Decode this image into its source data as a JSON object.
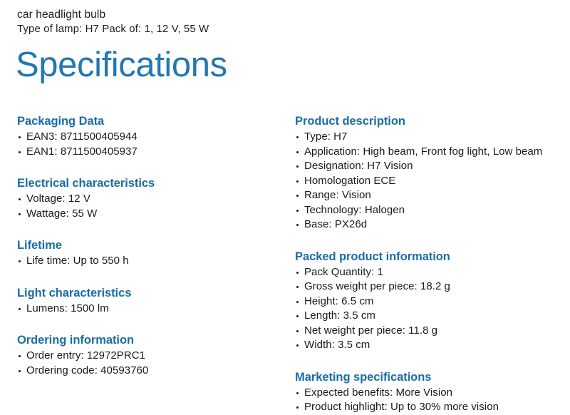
{
  "header": {
    "product_name": "car headlight bulb",
    "product_subtitle": "Type of lamp: H7 Pack of: 1, 12 V, 55 W",
    "page_title": "Specifications"
  },
  "colors": {
    "title_blue": "#2278b0",
    "heading_blue": "#1a6da5",
    "body_text": "#1a1a1a",
    "background": "#ffffff"
  },
  "left_column": [
    {
      "heading": "Packaging Data",
      "items": [
        "EAN3: 8711500405944",
        "EAN1: 8711500405937"
      ]
    },
    {
      "heading": "Electrical characteristics",
      "items": [
        "Voltage: 12 V",
        "Wattage: 55 W"
      ]
    },
    {
      "heading": "Lifetime",
      "items": [
        "Life time: Up to 550 h"
      ]
    },
    {
      "heading": "Light characteristics",
      "items": [
        "Lumens: 1500 lm"
      ]
    },
    {
      "heading": "Ordering information",
      "items": [
        "Order entry: 12972PRC1",
        "Ordering code: 40593760"
      ]
    }
  ],
  "right_column": [
    {
      "heading": "Product description",
      "items": [
        "Type: H7",
        "Application: High beam, Front fog light, Low beam",
        "Designation: H7 Vision",
        "Homologation ECE",
        "Range: Vision",
        "Technology: Halogen",
        "Base: PX26d"
      ]
    },
    {
      "heading": "Packed product information",
      "items": [
        "Pack Quantity: 1",
        "Gross weight per piece: 18.2 g",
        "Height: 6.5 cm",
        "Length: 3.5 cm",
        "Net weight per piece: 11.8 g",
        "Width: 3.5 cm"
      ]
    },
    {
      "heading": "Marketing specifications",
      "items": [
        "Expected benefits: More Vision",
        "Product highlight: Up to 30% more vision"
      ]
    }
  ]
}
